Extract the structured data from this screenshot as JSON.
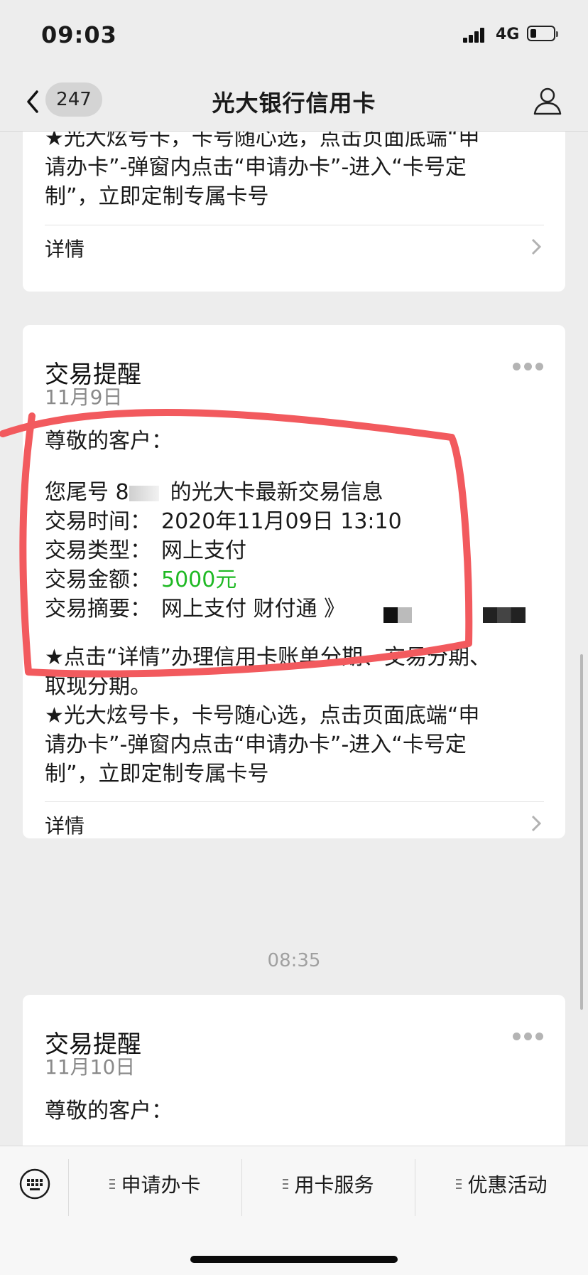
{
  "status_bar": {
    "time": "09:03",
    "network": "4G"
  },
  "nav": {
    "back_count": "247",
    "title": "光大银行信用卡"
  },
  "card1": {
    "lines": [
      "★光大炫号卡，卡号随心选，点击页面底端“申",
      "请办卡”-弹窗内点击“申请办卡”-进入“卡号定",
      "制”，立即定制专属卡号"
    ],
    "detail_label": "详情"
  },
  "card2": {
    "title": "交易提醒",
    "date": "11月9日",
    "greeting": "尊敬的客户：",
    "card_line_prefix": "您尾号 8",
    "card_line_suffix": "的光大卡最新交易信息",
    "rows": {
      "time_label": "交易时间：",
      "time_value": "2020年11月09日  13:10",
      "type_label": "交易类型：",
      "type_value": "网上支付",
      "amount_label": "交易金额：",
      "amount_value": "5000元",
      "summary_label": "交易摘要：",
      "summary_value": "网上支付 财付通 》"
    },
    "footer_lines": [
      "★点击“详情”办理信用卡账单分期、交易分期、",
      "取现分期。",
      "★光大炫号卡，卡号随心选，点击页面底端“申",
      "请办卡”-弹窗内点击“申请办卡”-进入“卡号定",
      "制”，立即定制专属卡号"
    ],
    "detail_label": "详情"
  },
  "timestamp": "08:35",
  "card3": {
    "title": "交易提醒",
    "date": "11月10日",
    "greeting": "尊敬的客户："
  },
  "menu": {
    "item1": "申请办卡",
    "item2": "用卡服务",
    "item3": "优惠活动"
  },
  "colors": {
    "amount_green": "#1fb924",
    "annotation_red": "#f25a5e",
    "background": "#ededed"
  }
}
